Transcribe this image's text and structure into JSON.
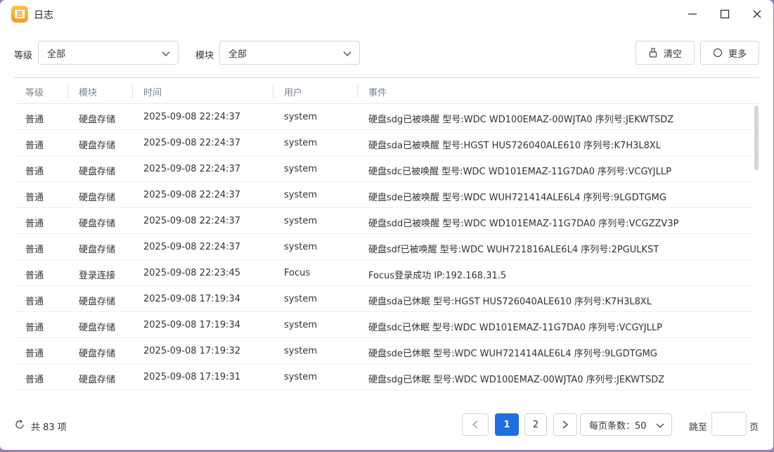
{
  "window": {
    "title": "日志"
  },
  "toolbar": {
    "level_label": "等级",
    "level_value": "全部",
    "module_label": "模块",
    "module_value": "全部",
    "clear_label": "清空",
    "more_label": "更多"
  },
  "table": {
    "columns": [
      "等级",
      "模块",
      "时间",
      "用户",
      "事件"
    ],
    "rows": [
      {
        "level": "普通",
        "module": "硬盘存储",
        "time": "2025-09-08 22:24:37",
        "user": "system",
        "event": "硬盘sdg已被唤醒 型号:WDC WD100EMAZ-00WJTA0 序列号:JEKWTSDZ"
      },
      {
        "level": "普通",
        "module": "硬盘存储",
        "time": "2025-09-08 22:24:37",
        "user": "system",
        "event": "硬盘sda已被唤醒 型号:HGST HUS726040ALE610 序列号:K7H3L8XL"
      },
      {
        "level": "普通",
        "module": "硬盘存储",
        "time": "2025-09-08 22:24:37",
        "user": "system",
        "event": "硬盘sdc已被唤醒 型号:WDC WD101EMAZ-11G7DA0 序列号:VCGYJLLP"
      },
      {
        "level": "普通",
        "module": "硬盘存储",
        "time": "2025-09-08 22:24:37",
        "user": "system",
        "event": "硬盘sde已被唤醒 型号:WDC WUH721414ALE6L4 序列号:9LGDTGMG"
      },
      {
        "level": "普通",
        "module": "硬盘存储",
        "time": "2025-09-08 22:24:37",
        "user": "system",
        "event": "硬盘sdd已被唤醒 型号:WDC WD101EMAZ-11G7DA0 序列号:VCGZZV3P"
      },
      {
        "level": "普通",
        "module": "硬盘存储",
        "time": "2025-09-08 22:24:37",
        "user": "system",
        "event": "硬盘sdf已被唤醒 型号:WDC WUH721816ALE6L4 序列号:2PGULKST"
      },
      {
        "level": "普通",
        "module": "登录连接",
        "time": "2025-09-08 22:23:45",
        "user": "Focus",
        "event": "Focus登录成功 IP:192.168.31.5"
      },
      {
        "level": "普通",
        "module": "硬盘存储",
        "time": "2025-09-08 17:19:34",
        "user": "system",
        "event": "硬盘sda已休眠 型号:HGST HUS726040ALE610 序列号:K7H3L8XL"
      },
      {
        "level": "普通",
        "module": "硬盘存储",
        "time": "2025-09-08 17:19:34",
        "user": "system",
        "event": "硬盘sdc已休眠 型号:WDC WD101EMAZ-11G7DA0 序列号:VCGYJLLP"
      },
      {
        "level": "普通",
        "module": "硬盘存储",
        "time": "2025-09-08 17:19:32",
        "user": "system",
        "event": "硬盘sde已休眠 型号:WDC WUH721414ALE6L4 序列号:9LGDTGMG"
      },
      {
        "level": "普通",
        "module": "硬盘存储",
        "time": "2025-09-08 17:19:31",
        "user": "system",
        "event": "硬盘sdg已休眠 型号:WDC WD100EMAZ-00WJTA0 序列号:JEKWTSDZ"
      }
    ]
  },
  "footer": {
    "total": "共 83 项",
    "pages": [
      "1",
      "2"
    ],
    "current_page": "1",
    "page_size": "每页条数：50",
    "jump_label": "跳至",
    "jump_value": "",
    "page_unit": "页"
  },
  "colors": {
    "accent": "#1f6fe0",
    "app_icon": "#f5a623"
  }
}
